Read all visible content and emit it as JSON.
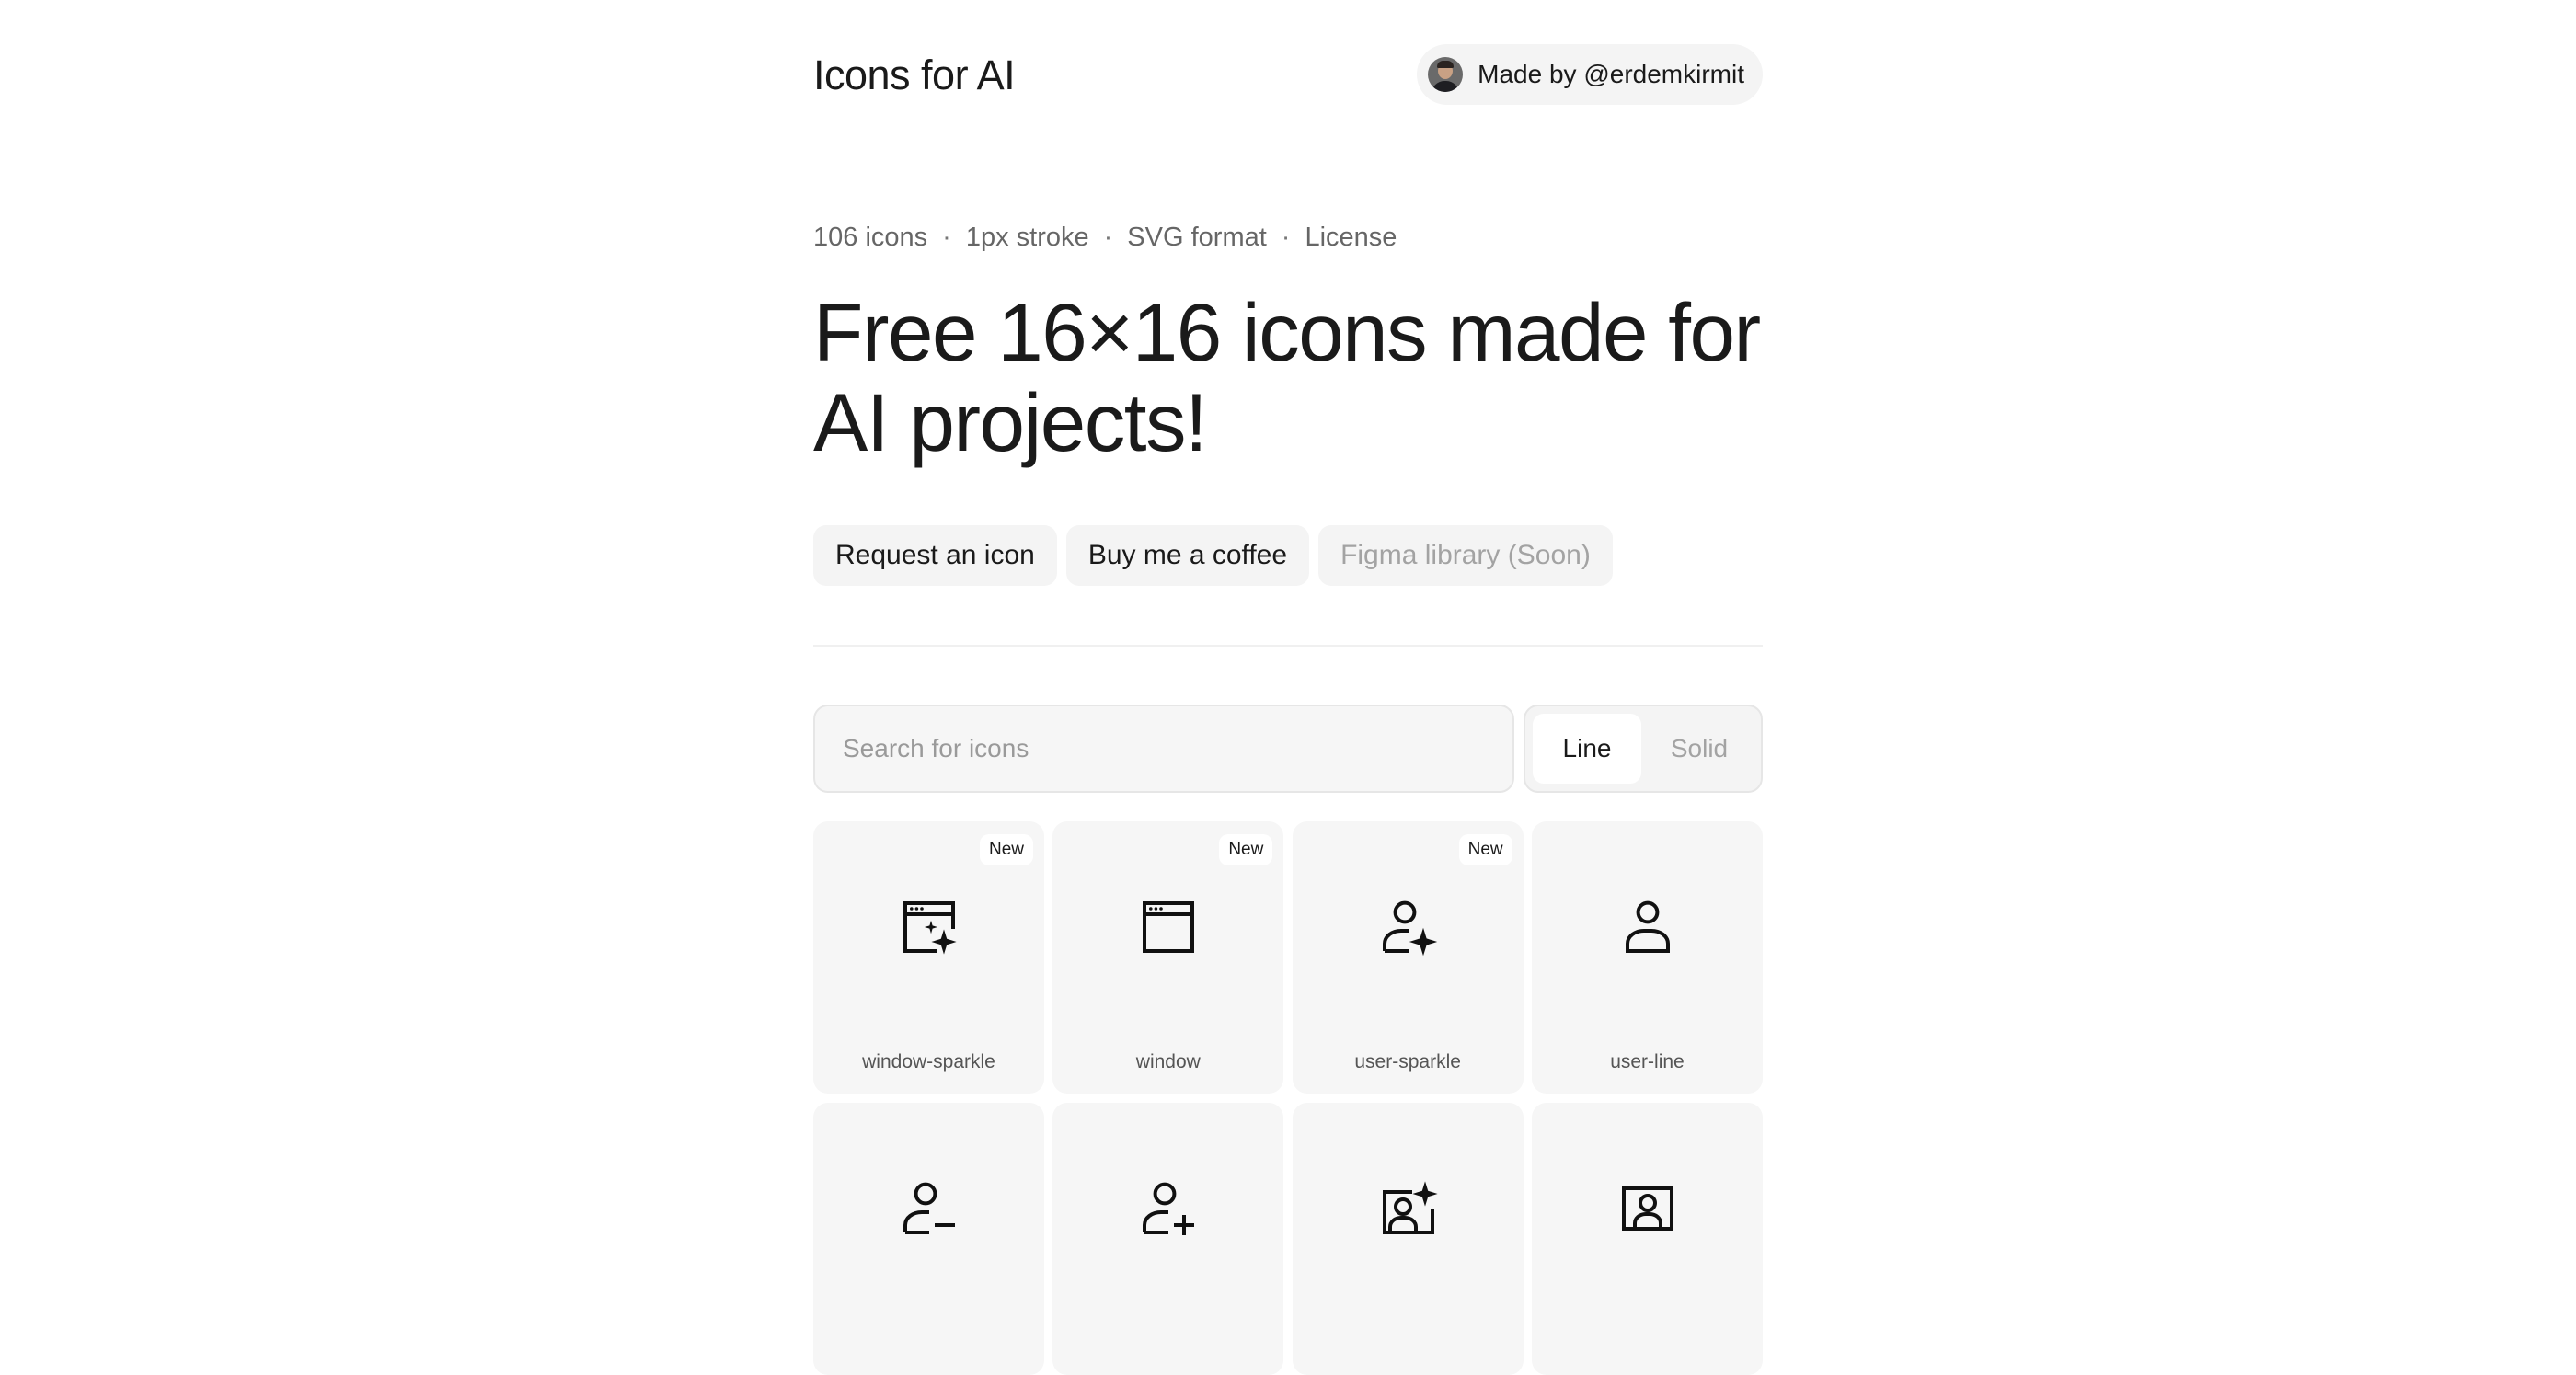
{
  "header": {
    "title": "Icons for AI",
    "author_label": "Made by @erdemkirmit"
  },
  "meta": {
    "count": "106 icons",
    "stroke": "1px stroke",
    "format": "SVG format",
    "license": "License"
  },
  "hero": {
    "headline_line1": "Free 16×16 icons made for",
    "headline_line2": "AI projects!"
  },
  "actions": {
    "request": "Request an icon",
    "coffee": "Buy me a coffee",
    "figma": "Figma library (Soon)"
  },
  "search": {
    "placeholder": "Search for icons",
    "value": ""
  },
  "style_toggle": {
    "line": "Line",
    "solid": "Solid",
    "selected": "Line"
  },
  "icons": [
    {
      "name": "window-sparkle",
      "badge": "New",
      "icon": "window-sparkle-icon"
    },
    {
      "name": "window",
      "badge": "New",
      "icon": "window-icon"
    },
    {
      "name": "user-sparkle",
      "badge": "New",
      "icon": "user-sparkle-icon"
    },
    {
      "name": "user-line",
      "badge": "",
      "icon": "user-icon"
    },
    {
      "name": "",
      "badge": "",
      "icon": "user-minus-icon"
    },
    {
      "name": "",
      "badge": "",
      "icon": "user-plus-icon"
    },
    {
      "name": "",
      "badge": "",
      "icon": "user-square-sparkle-icon"
    },
    {
      "name": "",
      "badge": "",
      "icon": "user-square-icon"
    }
  ],
  "colors": {
    "text": "#1a1a1a",
    "muted": "#666666",
    "card_bg": "#f6f6f6",
    "chip_bg": "#f4f4f4"
  }
}
